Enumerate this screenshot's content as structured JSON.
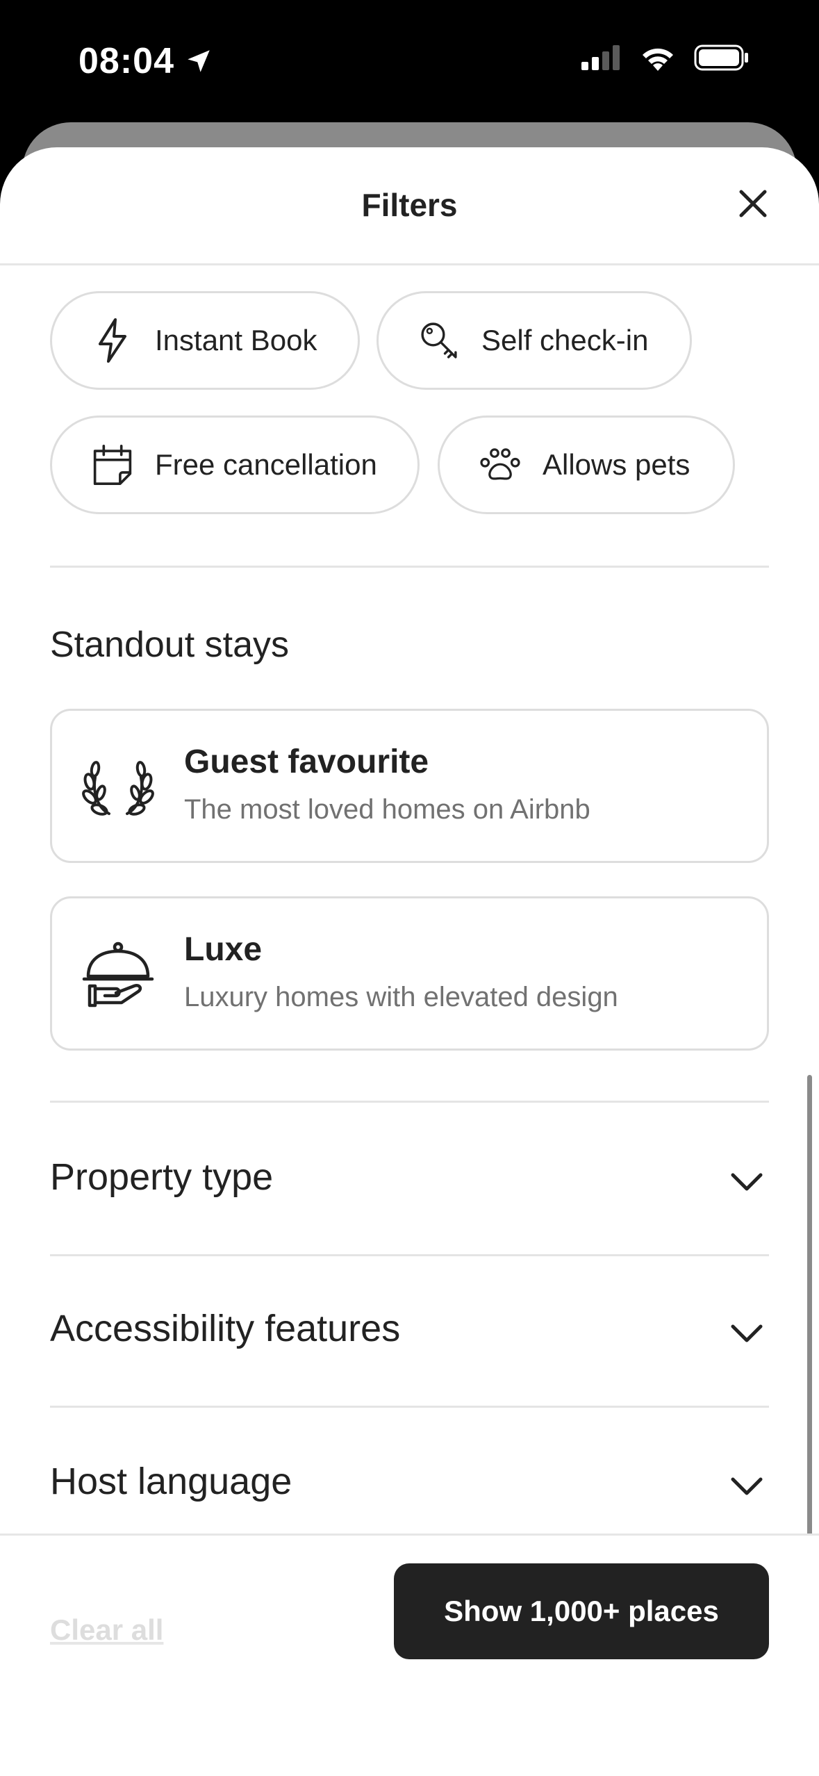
{
  "status_bar": {
    "time": "08:04",
    "icons": [
      "location-arrow-icon",
      "cellular-signal-icon",
      "wifi-icon",
      "battery-icon"
    ]
  },
  "header": {
    "title": "Filters",
    "close_icon": "close-icon"
  },
  "booking_options": [
    {
      "label": "Instant Book",
      "icon": "lightning-icon"
    },
    {
      "label": "Self check-in",
      "icon": "key-icon"
    },
    {
      "label": "Free cancellation",
      "icon": "calendar-icon"
    },
    {
      "label": "Allows pets",
      "icon": "paw-icon"
    }
  ],
  "standout": {
    "title": "Standout stays",
    "cards": [
      {
        "title": "Guest favourite",
        "subtitle": "The most loved homes on Airbnb",
        "icon": "laurel-icon"
      },
      {
        "title": "Luxe",
        "subtitle": "Luxury homes with elevated design",
        "icon": "cloche-icon"
      }
    ]
  },
  "accordions": [
    {
      "label": "Property type",
      "icon": "chevron-down-icon"
    },
    {
      "label": "Accessibility features",
      "icon": "chevron-down-icon"
    },
    {
      "label": "Host language",
      "icon": "chevron-down-icon"
    }
  ],
  "footer": {
    "clear_all": "Clear all",
    "show_button": "Show 1,000+ places"
  },
  "colors": {
    "text": "#222222",
    "muted": "#717171",
    "border": "#dddddd",
    "button_bg": "#222222",
    "disabled": "#dddddd"
  }
}
